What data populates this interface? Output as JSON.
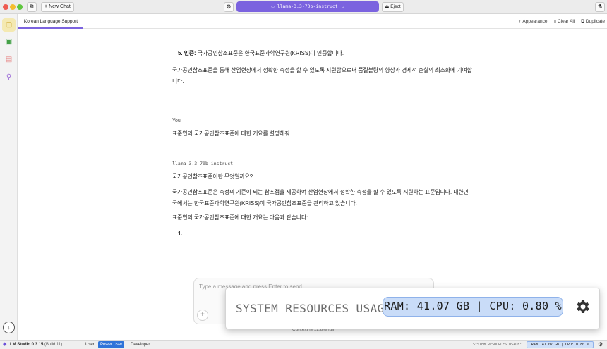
{
  "titlebar": {
    "new_chat_label": "New Chat",
    "model_name": "llama-3.3-70b-instruct",
    "eject_label": "Eject"
  },
  "tabs": [
    {
      "label": "Korean Language Support"
    }
  ],
  "tab_actions": {
    "appearance": "Appearance",
    "clear_all": "Clear All",
    "duplicate": "Duplicate"
  },
  "chat": {
    "item5_num": "5.",
    "item5_title": "인증:",
    "item5_text": " 국가공인참조표준은 한국표준과학연구원(KRISS)이 인증합니다.",
    "summary": "국가공인참조표준을 통해 산업현장에서 정확한 측정을 할 수 있도록 지원함으로써 품질불량의 향상과 경제적 손실의 최소화에 기여합니다.",
    "user_sender": "You",
    "user_message": "표준연의 국가공인참조표준에 대한 개요를 설명해줘",
    "assistant_sender": "llama-3.3-70b-instruct",
    "question": "국가공인참조표준이란 무엇일까요?",
    "answer": "국가공인참조표준은 측정의 기준이 되는 참조점을 제공하여 산업현장에서 정확한 측정을 할 수 있도록 지원하는 표준입니다. 대한민국에서는 한국표준과학연구원(KRISS)이 국가공인참조표준을 관리하고 있습니다.",
    "intro": "표준연의 국가공인참조표준에 대한 개요는 다음과 같습니다:",
    "list_start": "1."
  },
  "input": {
    "placeholder": "Type a message and press Enter to send ...",
    "context_note": "Context is 12.8% full"
  },
  "resources_popup": {
    "label": "SYSTEM RESOURCES USAGE:",
    "value": "RAM: 41.07 GB | CPU: 0.80 %"
  },
  "statusbar": {
    "app_name": "LM Studio 0.3.15",
    "build": "(Build 11)",
    "modes": [
      "User",
      "Power User",
      "Developer"
    ],
    "active_mode": "Power User",
    "resources_label": "SYSTEM RESOURCES USAGE:",
    "resources_value": "RAM: 41.07 GB | CPU: 0.80 %"
  },
  "colors": {
    "accent": "#7b63df",
    "power_user": "#2f74d9",
    "resource_pill": "#c9dcf8"
  },
  "icons": {
    "rail": [
      "chat-icon",
      "terminal-icon",
      "folder-icon",
      "search-icon"
    ],
    "download": "download-icon",
    "settings": "gear-icon",
    "flask": "flask-icon"
  }
}
